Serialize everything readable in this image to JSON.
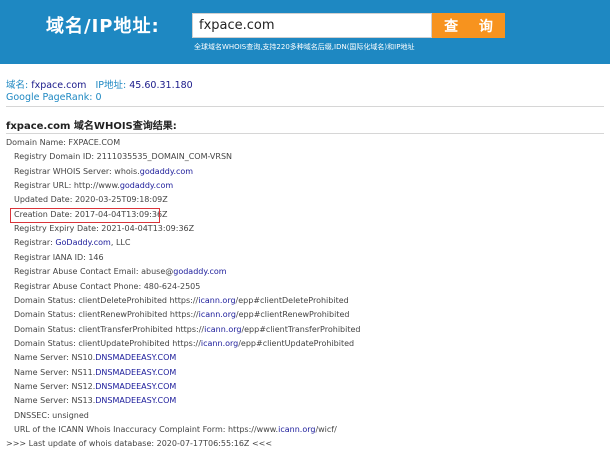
{
  "header": {
    "brand": "域名/IP地址:",
    "search_value": "fxpace.com",
    "query_button": "查 询",
    "subtitle": "全球域名WHOIS查询,支持220多种域名后缀,IDN(国际化域名)和IP地址"
  },
  "summary": {
    "domain_label": "域名:",
    "domain_value": "fxpace.com",
    "ip_label": "IP地址:",
    "ip_value": "45.60.31.180",
    "pagerank_label": "Google PageRank:",
    "pagerank_value": "0"
  },
  "result_title": "fxpace.com 域名WHOIS查询结果:",
  "records": [
    {
      "indent": false,
      "parts": [
        {
          "t": "Domain Name: FXPACE.COM"
        }
      ]
    },
    {
      "indent": true,
      "parts": [
        {
          "t": "Registry Domain ID: 2111035535_DOMAIN_COM-VRSN"
        }
      ]
    },
    {
      "indent": true,
      "parts": [
        {
          "t": "Registrar WHOIS Server: whois."
        },
        {
          "t": "godaddy.com",
          "link": true
        }
      ]
    },
    {
      "indent": true,
      "parts": [
        {
          "t": "Registrar URL: http://www."
        },
        {
          "t": "godaddy.com",
          "link": true
        }
      ]
    },
    {
      "indent": true,
      "parts": [
        {
          "t": "Updated Date: 2020-03-25T09:18:09Z"
        }
      ]
    },
    {
      "indent": true,
      "parts": [
        {
          "t": "Creation Date: 2017-04-04T13:09:36Z"
        }
      ]
    },
    {
      "indent": true,
      "parts": [
        {
          "t": "Registry Expiry Date: 2021-04-04T13:09:36Z"
        }
      ]
    },
    {
      "indent": true,
      "parts": [
        {
          "t": "Registrar: "
        },
        {
          "t": "GoDaddy.com",
          "link": true
        },
        {
          "t": ", LLC"
        }
      ]
    },
    {
      "indent": true,
      "parts": [
        {
          "t": "Registrar IANA ID: 146"
        }
      ]
    },
    {
      "indent": true,
      "parts": [
        {
          "t": "Registrar Abuse Contact Email: abuse@"
        },
        {
          "t": "godaddy.com",
          "link": true
        }
      ]
    },
    {
      "indent": true,
      "parts": [
        {
          "t": "Registrar Abuse Contact Phone: 480-624-2505"
        }
      ]
    },
    {
      "indent": true,
      "parts": [
        {
          "t": "Domain Status: clientDeleteProhibited https://"
        },
        {
          "t": "icann.org",
          "link": true
        },
        {
          "t": "/epp#clientDeleteProhibited"
        }
      ]
    },
    {
      "indent": true,
      "parts": [
        {
          "t": "Domain Status: clientRenewProhibited https://"
        },
        {
          "t": "icann.org",
          "link": true
        },
        {
          "t": "/epp#clientRenewProhibited"
        }
      ]
    },
    {
      "indent": true,
      "parts": [
        {
          "t": "Domain Status: clientTransferProhibited https://"
        },
        {
          "t": "icann.org",
          "link": true
        },
        {
          "t": "/epp#clientTransferProhibited"
        }
      ]
    },
    {
      "indent": true,
      "parts": [
        {
          "t": "Domain Status: clientUpdateProhibited https://"
        },
        {
          "t": "icann.org",
          "link": true
        },
        {
          "t": "/epp#clientUpdateProhibited"
        }
      ]
    },
    {
      "indent": true,
      "parts": [
        {
          "t": "Name Server: NS10."
        },
        {
          "t": "DNSMADEEASY.COM",
          "link": true
        }
      ]
    },
    {
      "indent": true,
      "parts": [
        {
          "t": "Name Server: NS11."
        },
        {
          "t": "DNSMADEEASY.COM",
          "link": true
        }
      ]
    },
    {
      "indent": true,
      "parts": [
        {
          "t": "Name Server: NS12."
        },
        {
          "t": "DNSMADEEASY.COM",
          "link": true
        }
      ]
    },
    {
      "indent": true,
      "parts": [
        {
          "t": "Name Server: NS13."
        },
        {
          "t": "DNSMADEEASY.COM",
          "link": true
        }
      ]
    },
    {
      "indent": true,
      "parts": [
        {
          "t": "DNSSEC: unsigned"
        }
      ]
    },
    {
      "indent": true,
      "parts": [
        {
          "t": "URL of the ICANN Whois Inaccuracy Complaint Form: https://www."
        },
        {
          "t": "icann.org",
          "link": true
        },
        {
          "t": "/wicf/"
        }
      ]
    },
    {
      "indent": false,
      "parts": [
        {
          "t": ">>> Last update of whois database: 2020-07-17T06:55:16Z <<<"
        }
      ]
    }
  ],
  "highlight_color": "#d9343a",
  "accent_color": "#1e88c2"
}
